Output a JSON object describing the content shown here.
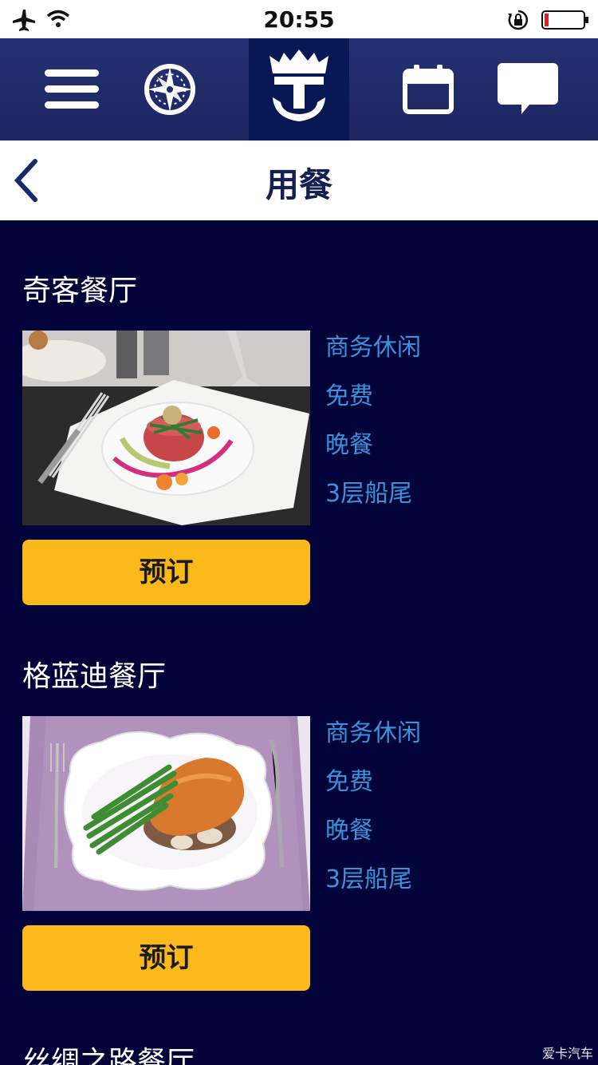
{
  "status_bar": {
    "time": "20:55"
  },
  "page": {
    "title": "用餐"
  },
  "restaurants": [
    {
      "name": "奇客餐厅",
      "info": [
        "商务休闲",
        "免费",
        "晚餐",
        "3层船尾"
      ],
      "book_label": "预订"
    },
    {
      "name": "格蓝迪餐厅",
      "info": [
        "商务休闲",
        "免费",
        "晚餐",
        "3层船尾"
      ],
      "book_label": "预订"
    },
    {
      "name": "丝绸之路餐厅"
    }
  ],
  "watermark": "爱卡汽车",
  "colors": {
    "nav_bg": "#1f2a68",
    "content_bg": "#020339",
    "accent_button": "#fbb81a",
    "info_text": "#3a93d8"
  }
}
